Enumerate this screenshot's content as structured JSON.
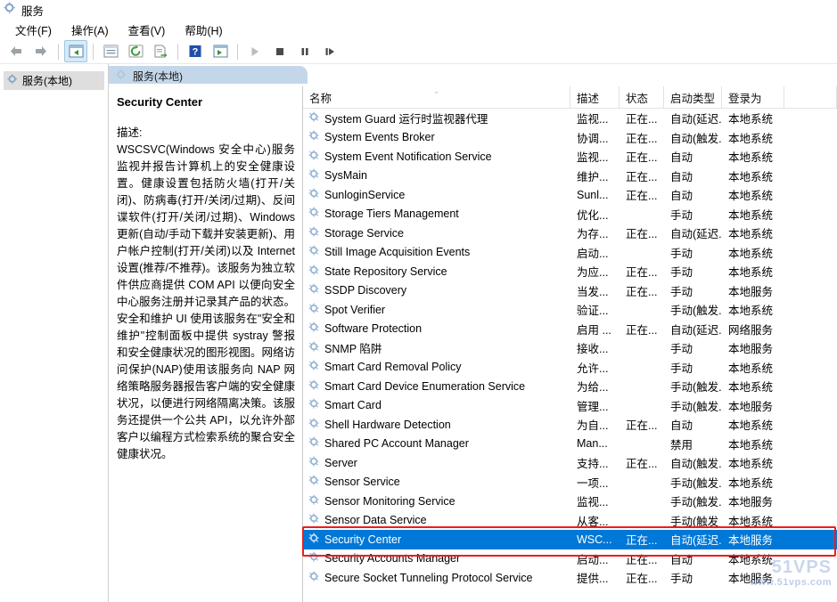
{
  "window": {
    "title": "服务",
    "icon": "services-gear-icon"
  },
  "menubar": {
    "items": [
      {
        "label": "文件(F)",
        "name": "menu-file"
      },
      {
        "label": "操作(A)",
        "name": "menu-action"
      },
      {
        "label": "查看(V)",
        "name": "menu-view"
      },
      {
        "label": "帮助(H)",
        "name": "menu-help"
      }
    ]
  },
  "toolbar": {
    "buttons": [
      {
        "name": "back-icon",
        "glyph": "back"
      },
      {
        "name": "forward-icon",
        "glyph": "forward"
      },
      {
        "name": "show-hide-tree-icon",
        "glyph": "tree"
      },
      {
        "name": "properties-icon",
        "glyph": "properties"
      },
      {
        "name": "refresh-icon",
        "glyph": "refresh"
      },
      {
        "name": "export-list-icon",
        "glyph": "export"
      },
      {
        "name": "help-icon",
        "glyph": "help"
      },
      {
        "name": "show-hide-action-pane-icon",
        "glyph": "actionpane"
      },
      {
        "name": "start-service-icon",
        "glyph": "play"
      },
      {
        "name": "stop-service-icon",
        "glyph": "stop"
      },
      {
        "name": "pause-service-icon",
        "glyph": "pause"
      },
      {
        "name": "restart-service-icon",
        "glyph": "restart"
      }
    ]
  },
  "tree": {
    "root_label": "服务(本地)"
  },
  "tab": {
    "label": "服务(本地)"
  },
  "details": {
    "title": "Security Center",
    "description_label": "描述:",
    "description_text": "WSCSVC(Windows 安全中心)服务监视并报告计算机上的安全健康设置。健康设置包括防火墙(打开/关闭)、防病毒(打开/关闭/过期)、反间谍软件(打开/关闭/过期)、Windows 更新(自动/手动下载并安装更新)、用户帐户控制(打开/关闭)以及 Internet 设置(推荐/不推荐)。该服务为独立软件供应商提供 COM API 以便向安全中心服务注册并记录其产品的状态。安全和维护 UI 使用该服务在\"安全和维护\"控制面板中提供 systray 警报和安全健康状况的图形视图。网络访问保护(NAP)使用该服务向 NAP 网络策略服务器报告客户端的安全健康状况，以便进行网络隔离决策。该服务还提供一个公共 API，以允许外部客户以编程方式检索系统的聚合安全健康状况。"
  },
  "list": {
    "columns": [
      {
        "label": "名称",
        "key": "name",
        "sorted": "desc"
      },
      {
        "label": "描述",
        "key": "desc"
      },
      {
        "label": "状态",
        "key": "status"
      },
      {
        "label": "启动类型",
        "key": "startup"
      },
      {
        "label": "登录为",
        "key": "logon"
      }
    ],
    "rows": [
      {
        "name": "System Guard 运行时监视器代理",
        "desc": "监视...",
        "status": "正在...",
        "startup": "自动(延迟...",
        "logon": "本地系统"
      },
      {
        "name": "System Events Broker",
        "desc": "协调...",
        "status": "正在...",
        "startup": "自动(触发...",
        "logon": "本地系统"
      },
      {
        "name": "System Event Notification Service",
        "desc": "监视...",
        "status": "正在...",
        "startup": "自动",
        "logon": "本地系统"
      },
      {
        "name": "SysMain",
        "desc": "维护...",
        "status": "正在...",
        "startup": "自动",
        "logon": "本地系统"
      },
      {
        "name": "SunloginService",
        "desc": "Sunl...",
        "status": "正在...",
        "startup": "自动",
        "logon": "本地系统"
      },
      {
        "name": "Storage Tiers Management",
        "desc": "优化...",
        "status": "",
        "startup": "手动",
        "logon": "本地系统"
      },
      {
        "name": "Storage Service",
        "desc": "为存...",
        "status": "正在...",
        "startup": "自动(延迟...",
        "logon": "本地系统"
      },
      {
        "name": "Still Image Acquisition Events",
        "desc": "启动...",
        "status": "",
        "startup": "手动",
        "logon": "本地系统"
      },
      {
        "name": "State Repository Service",
        "desc": "为应...",
        "status": "正在...",
        "startup": "手动",
        "logon": "本地系统"
      },
      {
        "name": "SSDP Discovery",
        "desc": "当发...",
        "status": "正在...",
        "startup": "手动",
        "logon": "本地服务"
      },
      {
        "name": "Spot Verifier",
        "desc": "验证...",
        "status": "",
        "startup": "手动(触发...",
        "logon": "本地系统"
      },
      {
        "name": "Software Protection",
        "desc": "启用 ...",
        "status": "正在...",
        "startup": "自动(延迟...",
        "logon": "网络服务"
      },
      {
        "name": "SNMP 陷阱",
        "desc": "接收...",
        "status": "",
        "startup": "手动",
        "logon": "本地服务"
      },
      {
        "name": "Smart Card Removal Policy",
        "desc": "允许...",
        "status": "",
        "startup": "手动",
        "logon": "本地系统"
      },
      {
        "name": "Smart Card Device Enumeration Service",
        "desc": "为给...",
        "status": "",
        "startup": "手动(触发...",
        "logon": "本地系统"
      },
      {
        "name": "Smart Card",
        "desc": "管理...",
        "status": "",
        "startup": "手动(触发...",
        "logon": "本地服务"
      },
      {
        "name": "Shell Hardware Detection",
        "desc": "为自...",
        "status": "正在...",
        "startup": "自动",
        "logon": "本地系统"
      },
      {
        "name": "Shared PC Account Manager",
        "desc": "Man...",
        "status": "",
        "startup": "禁用",
        "logon": "本地系统"
      },
      {
        "name": "Server",
        "desc": "支持...",
        "status": "正在...",
        "startup": "自动(触发...",
        "logon": "本地系统"
      },
      {
        "name": "Sensor Service",
        "desc": "一项...",
        "status": "",
        "startup": "手动(触发...",
        "logon": "本地系统"
      },
      {
        "name": "Sensor Monitoring Service",
        "desc": "监视...",
        "status": "",
        "startup": "手动(触发...",
        "logon": "本地服务"
      },
      {
        "name": "Sensor Data Service",
        "desc": "从客...",
        "status": "",
        "startup": "手动(触发",
        "logon": "本地系统"
      },
      {
        "name": "Security Center",
        "desc": "WSC...",
        "status": "正在...",
        "startup": "自动(延迟...",
        "logon": "本地服务",
        "selected": true
      },
      {
        "name": "Security Accounts Manager",
        "desc": "启动...",
        "status": "正在...",
        "startup": "自动",
        "logon": "本地系统"
      },
      {
        "name": "Secure Socket Tunneling Protocol Service",
        "desc": "提供...",
        "status": "正在...",
        "startup": "手动",
        "logon": "本地服务"
      }
    ]
  },
  "annotation": {
    "color": "#ef1c1c",
    "target_row": "Security Center"
  },
  "watermark": {
    "line1": "51VPS",
    "line2": "www.51vps.com"
  }
}
